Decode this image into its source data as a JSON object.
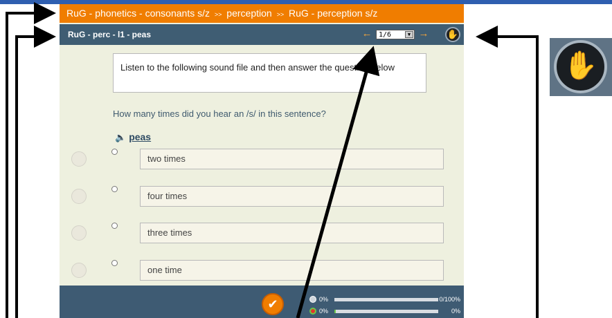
{
  "breadcrumb": {
    "part1": "RuG - phonetics - consonants s/z",
    "sep1": ">>",
    "part2": "perception",
    "sep2": ">>",
    "part3": "RuG - perception s/z"
  },
  "subbar": {
    "title": "RuG - perc - l1 - peas",
    "page_select": "1/6"
  },
  "instruction": "Listen to the following sound file and then answer the question below",
  "question": "How many times did you hear an /s/ in this sentence?",
  "sound_link": "peas",
  "options": [
    {
      "label": "two times"
    },
    {
      "label": "four times"
    },
    {
      "label": "three times"
    },
    {
      "label": "one time"
    }
  ],
  "progress": [
    {
      "pct": "0%",
      "value": "0/100%",
      "fill": 0
    },
    {
      "pct": "0%",
      "value": "0%",
      "fill": 0.01
    }
  ],
  "colors": {
    "accent": "#f07d00",
    "header": "#3f5d73",
    "panel": "#eef0df"
  },
  "icons": [
    "left-arrow-icon",
    "right-arrow-icon",
    "hand-icon",
    "speaker-icon",
    "checkmark-icon"
  ]
}
